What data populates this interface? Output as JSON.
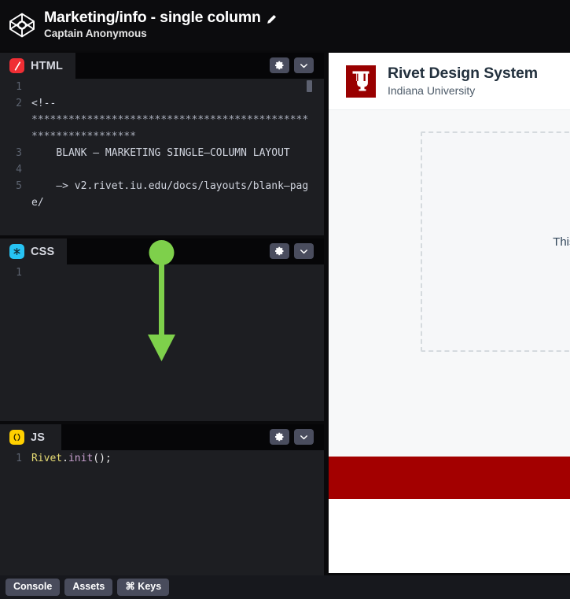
{
  "topbar": {
    "logo_icon": "codepen-logo-icon",
    "pen_title": "Marketing/info - single column",
    "edit_icon": "pencil-icon",
    "author": "Captain Anonymous"
  },
  "editors": [
    {
      "id": "html",
      "label": "HTML",
      "icon": "html5-slash-icon",
      "settings_icon": "gear-icon",
      "collapse_icon": "chevron-down-icon",
      "lines": [
        {
          "number": "1",
          "fold": false,
          "text": ""
        },
        {
          "number": "2",
          "fold": true,
          "text": "<!--"
        },
        {
          "number": "",
          "fold": false,
          "text": "**************************************************************"
        },
        {
          "number": "3",
          "fold": false,
          "text": "    BLANK – MARKETING SINGLE–COLUMN LAYOUT"
        },
        {
          "number": "4",
          "fold": false,
          "text": ""
        },
        {
          "number": "5",
          "fold": false,
          "text": "    –> v2.rivet.iu.edu/docs/layouts/blank–page/"
        }
      ]
    },
    {
      "id": "css",
      "label": "CSS",
      "icon": "css-asterisk-icon",
      "settings_icon": "gear-icon",
      "collapse_icon": "chevron-down-icon",
      "lines": [
        {
          "number": "1",
          "fold": false,
          "text": ""
        }
      ]
    },
    {
      "id": "js",
      "label": "JS",
      "icon": "js-parens-icon",
      "settings_icon": "gear-icon",
      "collapse_icon": "chevron-down-icon",
      "code_tokens": [
        {
          "text": "Rivet",
          "type": "var"
        },
        {
          "text": ".",
          "type": "plain"
        },
        {
          "text": "init",
          "type": "fn"
        },
        {
          "text": "();",
          "type": "plain"
        }
      ],
      "line_number": "1"
    }
  ],
  "annotation": {
    "name": "green-down-arrow",
    "color": "#7ed04b"
  },
  "preview": {
    "logo_icon": "iu-trident-icon",
    "brand_color": "#990000",
    "title": "Rivet Design System",
    "subtitle": "Indiana University",
    "placeholder_text": "This lay",
    "footer_bar_color": "#a30000"
  },
  "bottombar": {
    "buttons": [
      {
        "label": "Console",
        "name": "console-button"
      },
      {
        "label": "Assets",
        "name": "assets-button"
      },
      {
        "label": "⌘ Keys",
        "name": "keyboard-shortcuts-button"
      }
    ]
  }
}
